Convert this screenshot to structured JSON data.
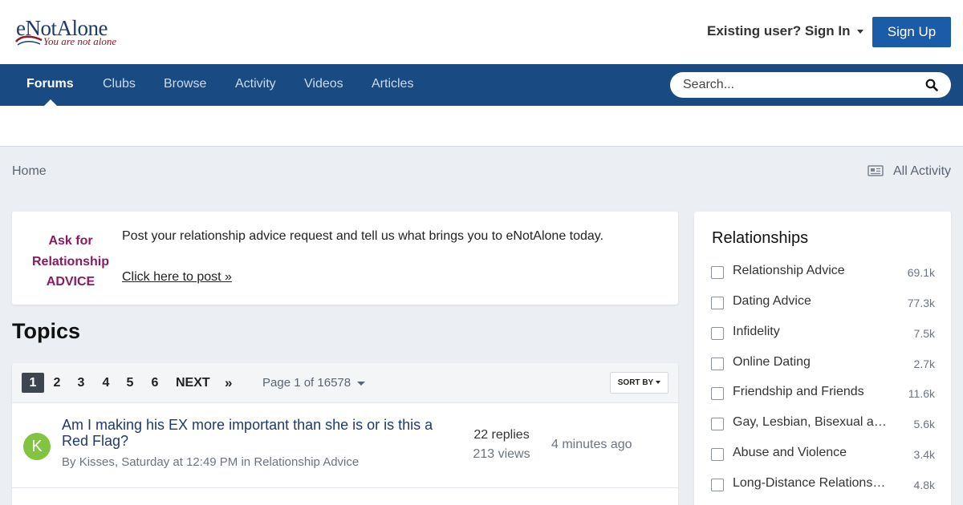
{
  "header": {
    "logo_main": "eNotAlone",
    "logo_tagline": "You are not alone",
    "signin_label": "Existing user? Sign In",
    "signup_label": "Sign Up"
  },
  "nav": {
    "items": [
      {
        "label": "Forums",
        "active": true
      },
      {
        "label": "Clubs"
      },
      {
        "label": "Browse"
      },
      {
        "label": "Activity"
      },
      {
        "label": "Videos"
      },
      {
        "label": "Articles"
      }
    ],
    "search_placeholder": "Search..."
  },
  "breadcrumb": {
    "home": "Home",
    "all_activity": "All Activity"
  },
  "advice": {
    "title": "Ask for Relationship ADVICE",
    "text": "Post your relationship advice request and tell us what brings you to eNotAlone today.",
    "link": "Click here to post »"
  },
  "topics": {
    "heading": "Topics",
    "pages": [
      "1",
      "2",
      "3",
      "4",
      "5",
      "6"
    ],
    "next_label": "NEXT",
    "last_label": "»",
    "page_of": "Page 1 of 16578",
    "sort_label": "SORT BY",
    "rows": [
      {
        "avatar_letter": "K",
        "avatar_color": "#82c441",
        "title": "Am I making his EX more important than she is or is this a Red Flag?",
        "by": "By ",
        "author": "Kisses",
        "date": ", Saturday at 12:49 PM in ",
        "forum": "Relationship Advice",
        "replies": "22 replies",
        "views": "213 views",
        "last_post": "4 minutes ago"
      }
    ]
  },
  "sidebar": {
    "title": "Relationships",
    "items": [
      {
        "label": "Relationship Advice",
        "count": "69.1k"
      },
      {
        "label": "Dating Advice",
        "count": "77.3k"
      },
      {
        "label": "Infidelity",
        "count": "7.5k"
      },
      {
        "label": "Online Dating",
        "count": "2.7k"
      },
      {
        "label": "Friendship and Friends",
        "count": "11.6k"
      },
      {
        "label": "Gay, Lesbian, Bisexual and Transgender",
        "count": "5.6k"
      },
      {
        "label": "Abuse and Violence",
        "count": "3.4k"
      },
      {
        "label": "Long-Distance Relationships",
        "count": "4.8k"
      }
    ]
  },
  "colors": {
    "nav_bg": "#1a4a82",
    "signup_bg": "#1a5ca8",
    "advice_title": "#8a1a5e",
    "topic_link": "#1e3a6e"
  }
}
